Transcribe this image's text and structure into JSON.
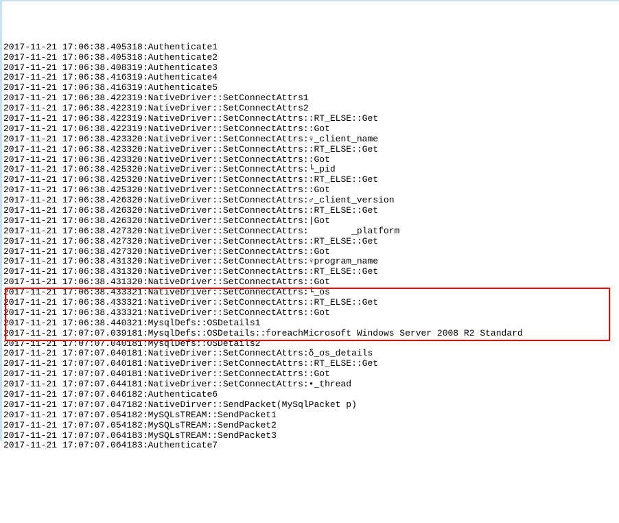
{
  "log_lines": [
    "2017-11-21 17:06:38.405318:Authenticate1",
    "2017-11-21 17:06:38.405318:Authenticate2",
    "2017-11-21 17:06:38.408319:Authenticate3",
    "2017-11-21 17:06:38.416319:Authenticate4",
    "2017-11-21 17:06:38.416319:Authenticate5",
    "2017-11-21 17:06:38.422319:NativeDriver::SetConnectAttrs1",
    "2017-11-21 17:06:38.422319:NativeDriver::SetConnectAttrs2",
    "2017-11-21 17:06:38.422319:NativeDriver::SetConnectAttrs::RT_ELSE::Get",
    "2017-11-21 17:06:38.422319:NativeDriver::SetConnectAttrs::Got",
    "2017-11-21 17:06:38.423320:NativeDriver::SetConnectAttrs:♀_client_name",
    "2017-11-21 17:06:38.423320:NativeDriver::SetConnectAttrs::RT_ELSE::Get",
    "2017-11-21 17:06:38.423320:NativeDriver::SetConnectAttrs::Got",
    "2017-11-21 17:06:38.425320:NativeDriver::SetConnectAttrs:└_pid",
    "2017-11-21 17:06:38.425320:NativeDriver::SetConnectAttrs::RT_ELSE::Get",
    "2017-11-21 17:06:38.425320:NativeDriver::SetConnectAttrs::Got",
    "2017-11-21 17:06:38.426320:NativeDriver::SetConnectAttrs:♂_client_version",
    "2017-11-21 17:06:38.426320:NativeDriver::SetConnectAttrs::RT_ELSE::Get",
    "2017-11-21 17:06:38.426320:NativeDriver::SetConnectAttrs:|Got",
    "2017-11-21 17:06:38.427320:NativeDriver::SetConnectAttrs:        _platform",
    "2017-11-21 17:06:38.427320:NativeDriver::SetConnectAttrs::RT_ELSE::Get",
    "2017-11-21 17:06:38.427320:NativeDriver::SetConnectAttrs::Got",
    "2017-11-21 17:06:38.431320:NativeDriver::SetConnectAttrs:♀program_name",
    "2017-11-21 17:06:38.431320:NativeDriver::SetConnectAttrs::RT_ELSE::Get",
    "2017-11-21 17:06:38.431320:NativeDriver::SetConnectAttrs::Got",
    "2017-11-21 17:06:38.433321:NativeDriver::SetConnectAttrs:└_os",
    "2017-11-21 17:06:38.433321:NativeDriver::SetConnectAttrs::RT_ELSE::Get",
    "2017-11-21 17:06:38.433321:NativeDriver::SetConnectAttrs::Got",
    "2017-11-21 17:06:38.440321:MysqlDefs::OSDetails1",
    "2017-11-21 17:07:07.039181:MysqlDefs::OSDetails::foreachMicrosoft Windows Server 2008 R2 Standard",
    "2017-11-21 17:07:07.040181:MysqlDefs::OSDetails2",
    "2017-11-21 17:07:07.040181:NativeDriver::SetConnectAttrs:δ_os_details",
    "2017-11-21 17:07:07.040181:NativeDriver::SetConnectAttrs::RT_ELSE::Get",
    "2017-11-21 17:07:07.040181:NativeDriver::SetConnectAttrs::Got",
    "2017-11-21 17:07:07.044181:NativeDriver::SetConnectAttrs:•_thread",
    "2017-11-21 17:07:07.046182:Authenticate6",
    "2017-11-21 17:07:07.047182:NativeDirver::SendPacket(MySqlPacket p)",
    "2017-11-21 17:07:07.054182:MySQLsTREAM::SendPacket1",
    "2017-11-21 17:07:07.054182:MySQLsTREAM::SendPacket2",
    "2017-11-21 17:07:07.064183:MySQLsTREAM::SendPacket3",
    "2017-11-21 17:07:07.064183:Authenticate7"
  ]
}
